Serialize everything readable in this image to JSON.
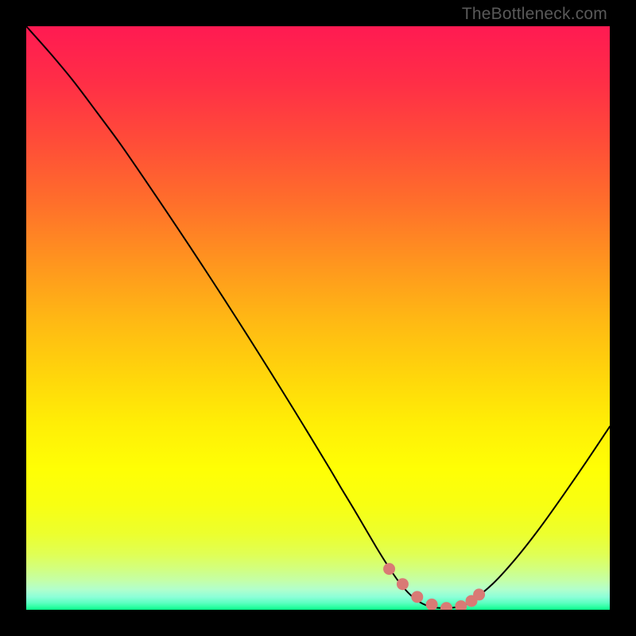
{
  "watermark": "TheBottleneck.com",
  "gradient_stops": [
    {
      "offset": 0.0,
      "color": "#ff1a52"
    },
    {
      "offset": 0.1,
      "color": "#ff2f46"
    },
    {
      "offset": 0.2,
      "color": "#ff4d38"
    },
    {
      "offset": 0.3,
      "color": "#ff6e2b"
    },
    {
      "offset": 0.4,
      "color": "#ff931f"
    },
    {
      "offset": 0.5,
      "color": "#ffb714"
    },
    {
      "offset": 0.6,
      "color": "#ffd60b"
    },
    {
      "offset": 0.68,
      "color": "#ffee06"
    },
    {
      "offset": 0.76,
      "color": "#ffff05"
    },
    {
      "offset": 0.82,
      "color": "#f8ff12"
    },
    {
      "offset": 0.87,
      "color": "#ecff2e"
    },
    {
      "offset": 0.905,
      "color": "#e0ff55"
    },
    {
      "offset": 0.93,
      "color": "#d2ff80"
    },
    {
      "offset": 0.95,
      "color": "#c4ffa8"
    },
    {
      "offset": 0.965,
      "color": "#b2ffcc"
    },
    {
      "offset": 0.978,
      "color": "#8cffd8"
    },
    {
      "offset": 0.988,
      "color": "#5effc2"
    },
    {
      "offset": 0.995,
      "color": "#2fffa4"
    },
    {
      "offset": 1.0,
      "color": "#0aff8a"
    }
  ],
  "marker_color": "#d97a75",
  "chart_data": {
    "type": "line",
    "title": "",
    "xlabel": "",
    "ylabel": "",
    "xlim": [
      0,
      100
    ],
    "ylim": [
      0,
      100
    ],
    "series": [
      {
        "name": "bottleneck-curve",
        "x": [
          0,
          4,
          8,
          12,
          16,
          20,
          24,
          28,
          32,
          36,
          40,
          44,
          48,
          52,
          54,
          56,
          58,
          60,
          62,
          64,
          66,
          68,
          70,
          72,
          74,
          76,
          80,
          84,
          88,
          92,
          96,
          100
        ],
        "y": [
          100,
          95.5,
          90.7,
          85.4,
          80.0,
          74.2,
          68.3,
          62.3,
          56.2,
          50.0,
          43.7,
          37.3,
          30.8,
          24.2,
          20.8,
          17.5,
          14.1,
          10.7,
          7.5,
          4.6,
          2.4,
          1.0,
          0.4,
          0.3,
          0.5,
          1.3,
          4.5,
          8.9,
          14.0,
          19.6,
          25.4,
          31.4
        ]
      }
    ],
    "markers": {
      "name": "fit-region",
      "color": "#d97a75",
      "x": [
        62.2,
        64.5,
        67.0,
        69.5,
        72.0,
        74.5,
        76.3,
        77.6
      ],
      "y": [
        7.0,
        4.4,
        2.2,
        0.9,
        0.3,
        0.6,
        1.5,
        2.6
      ]
    }
  }
}
